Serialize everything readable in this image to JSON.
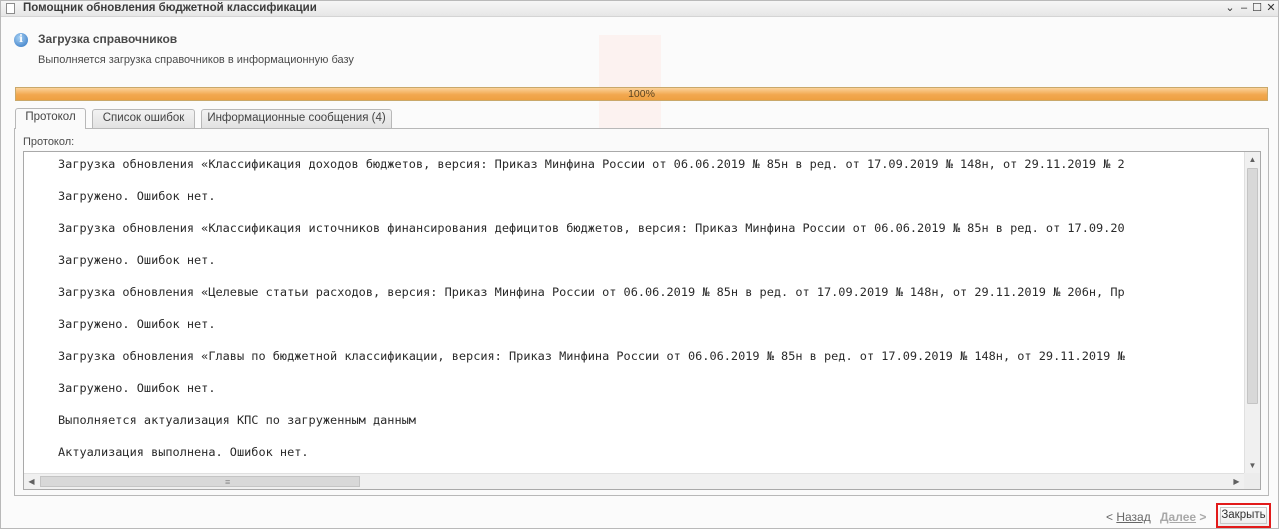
{
  "window": {
    "title": "Помощник обновления бюджетной классификации",
    "controls": {
      "menu": "⌄",
      "minimize": "–",
      "maximize": "☐",
      "close": "✕"
    }
  },
  "header": {
    "title": "Загрузка справочников",
    "subtitle": "Выполняется загрузка справочников в информационную базу",
    "icon": "info-icon"
  },
  "progress": {
    "value": 100,
    "label": "100%"
  },
  "tabs": [
    {
      "label": "Протокол",
      "active": true
    },
    {
      "label": "Список ошибок",
      "active": false
    },
    {
      "label": "Информационные сообщения (4)",
      "active": false
    }
  ],
  "log": {
    "label": "Протокол:",
    "lines": [
      "Загрузка обновления «Классификация доходов бюджетов, версия: Приказ Минфина России от 06.06.2019 № 85н в ред. от 17.09.2019 № 148н, от 29.11.2019 № 2",
      "Загружено. Ошибок нет.",
      "Загрузка обновления «Классификация источников финансирования дефицитов бюджетов, версия: Приказ Минфина России от 06.06.2019 № 85н в ред. от 17.09.20",
      "Загружено. Ошибок нет.",
      "Загрузка обновления «Целевые статьи расходов, версия: Приказ Минфина России от 06.06.2019 № 85н в ред. от 17.09.2019 № 148н, от 29.11.2019 № 206н, Пр",
      "Загружено. Ошибок нет.",
      "Загрузка обновления «Главы по бюджетной классификации, версия: Приказ Минфина России от 06.06.2019 № 85н в ред. от 17.09.2019 № 148н, от 29.11.2019 №",
      "Загружено. Ошибок нет.",
      "Выполняется актуализация КПС по загруженным данным",
      "Актуализация выполнена. Ошибок нет."
    ]
  },
  "footer": {
    "back_prefix": "< ",
    "back_label": "Назад",
    "next_label": "Далее",
    "next_suffix": " >",
    "close_label": "Закрыть"
  },
  "colors": {
    "progress_fill": "#f2a84f",
    "highlight_border": "#e21a1a"
  }
}
